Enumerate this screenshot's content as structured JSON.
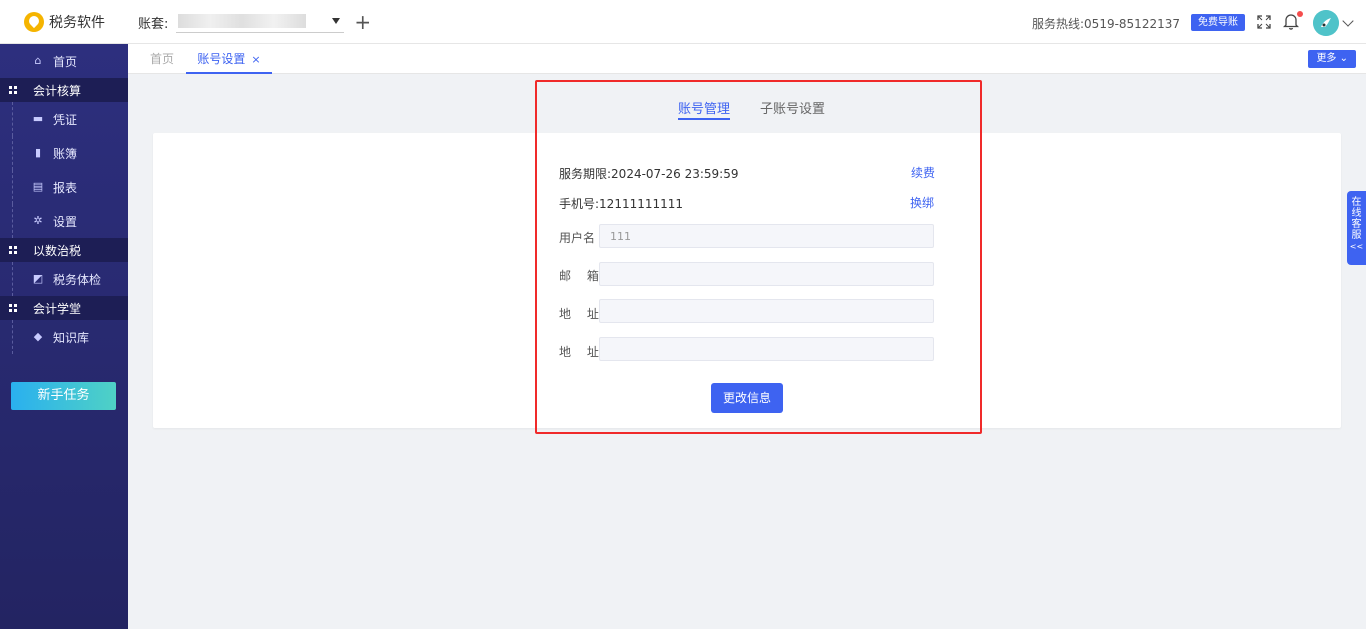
{
  "app": {
    "name": "税务软件"
  },
  "header": {
    "account_label": "账套:",
    "hotline": "服务热线:0519-85122137",
    "free_nav_label": "免费导账"
  },
  "sidebar": {
    "home": "首页",
    "groups": [
      {
        "label": "会计核算",
        "items": [
          "凭证",
          "账簿",
          "报表",
          "设置"
        ]
      },
      {
        "label": "以数治税",
        "items": [
          "税务体检"
        ]
      },
      {
        "label": "会计学堂",
        "items": [
          "知识库"
        ]
      }
    ],
    "task_button": "新手任务"
  },
  "tabs": {
    "home": "首页",
    "active": "账号设置",
    "close": "×",
    "more": "更多"
  },
  "account_settings": {
    "sub_tabs": [
      "账号管理",
      "子账号设置"
    ],
    "service_period_label": "服务期限:",
    "service_period_value": "2024-07-26 23:59:59",
    "renew_link": "续费",
    "phone_label": "手机号:",
    "phone_value": "12111111111",
    "rebind_link": "换绑",
    "fields": [
      {
        "label": "用户名",
        "value": "111"
      },
      {
        "label": "邮 箱",
        "value": ""
      },
      {
        "label": "地 址",
        "value": ""
      },
      {
        "label": "地 址",
        "value": ""
      }
    ],
    "update_button": "更改信息"
  },
  "float_service": {
    "label": "在线客服",
    "arrows": "<<"
  },
  "colors": {
    "accent": "#3e63f1",
    "sidebar": "#2d2f7e",
    "highlight": "#f02a2a"
  }
}
